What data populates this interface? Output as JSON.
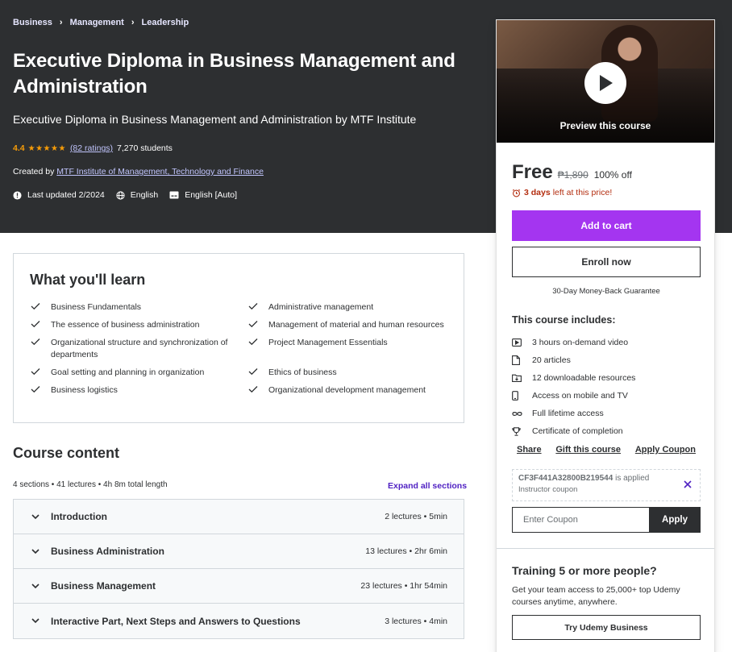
{
  "breadcrumb": [
    "Business",
    "Management",
    "Leadership"
  ],
  "course": {
    "title": "Executive Diploma in Business Management and Administration",
    "subtitle": "Executive Diploma in Business Management and Administration by MTF Institute",
    "rating": "4.4",
    "rating_stars": 4.4,
    "rating_count": "(82 ratings)",
    "students": "7,270 students",
    "created_by_label": "Created by",
    "author": "MTF Institute of Management, Technology and Finance",
    "last_updated": "Last updated 2/2024",
    "language": "English",
    "captions": "English [Auto]"
  },
  "sidebar": {
    "preview_label": "Preview this course",
    "price": "Free",
    "original_price": "₱1,890",
    "discount": "100% off",
    "timer_bold": "3 days",
    "timer_rest": "left at this price!",
    "add_to_cart": "Add to cart",
    "enroll_now": "Enroll now",
    "guarantee": "30-Day Money-Back Guarantee",
    "includes_title": "This course includes:",
    "includes": [
      {
        "icon": "video-icon",
        "text": "3 hours on-demand video"
      },
      {
        "icon": "article-icon",
        "text": "20 articles"
      },
      {
        "icon": "download-icon",
        "text": "12 downloadable resources"
      },
      {
        "icon": "mobile-icon",
        "text": "Access on mobile and TV"
      },
      {
        "icon": "infinity-icon",
        "text": "Full lifetime access"
      },
      {
        "icon": "trophy-icon",
        "text": "Certificate of completion"
      }
    ],
    "share": "Share",
    "gift": "Gift this course",
    "apply_coupon": "Apply Coupon",
    "coupon_code": "CF3F441A32800B219544",
    "coupon_applied": "is applied",
    "coupon_sub": "Instructor coupon",
    "coupon_placeholder": "Enter Coupon",
    "apply": "Apply",
    "team_title": "Training 5 or more people?",
    "team_text": "Get your team access to 25,000+ top Udemy courses anytime, anywhere.",
    "team_button": "Try Udemy Business"
  },
  "learn": {
    "title": "What you'll learn",
    "items": [
      "Business Fundamentals",
      "Administrative management",
      "The essence of business administration",
      "Management of material and human resources",
      "Organizational structure and synchronization of departments",
      "Project Management Essentials",
      "Goal setting and planning in organization",
      "Ethics of business",
      "Business logistics",
      "Organizational development management"
    ]
  },
  "content": {
    "title": "Course content",
    "meta": "4 sections • 41 lectures • 4h 8m total length",
    "expand_all": "Expand all sections",
    "sections": [
      {
        "name": "Introduction",
        "info": "2 lectures • 5min"
      },
      {
        "name": "Business Administration",
        "info": "13 lectures • 2hr 6min"
      },
      {
        "name": "Business Management",
        "info": "23 lectures • 1hr 54min"
      },
      {
        "name": "Interactive Part, Next Steps and Answers to Questions",
        "info": "3 lectures • 4min"
      }
    ]
  },
  "colors": {
    "header_bg": "#2d2f31",
    "accent_purple": "#a435f0",
    "star": "#f69c08",
    "link_purple": "#5022c3",
    "timer_red": "#b32d0f"
  }
}
